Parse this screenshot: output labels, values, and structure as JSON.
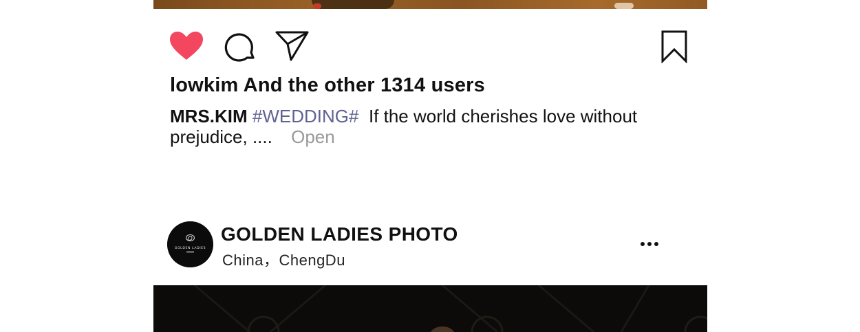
{
  "previous_post": {
    "actions": {
      "like_icon": "heart-icon",
      "comment_icon": "comment-bubble-icon",
      "share_icon": "paper-plane-icon",
      "save_icon": "bookmark-icon",
      "like_color": "#f2475e"
    },
    "likes_text": "lowkim And the other 1314 users",
    "caption": {
      "author": "MRS.KIM",
      "hashtag": "#WEDDING#",
      "text": "If the world cherishes love without prejudice, ....",
      "open_label": "Open"
    }
  },
  "next_post": {
    "account_name": "GOLDEN LADIES PHOTO",
    "location": "China，ChengDu",
    "avatar_logo_text": "GOLDEN LADIES",
    "more_icon": "more-horizontal-icon"
  }
}
